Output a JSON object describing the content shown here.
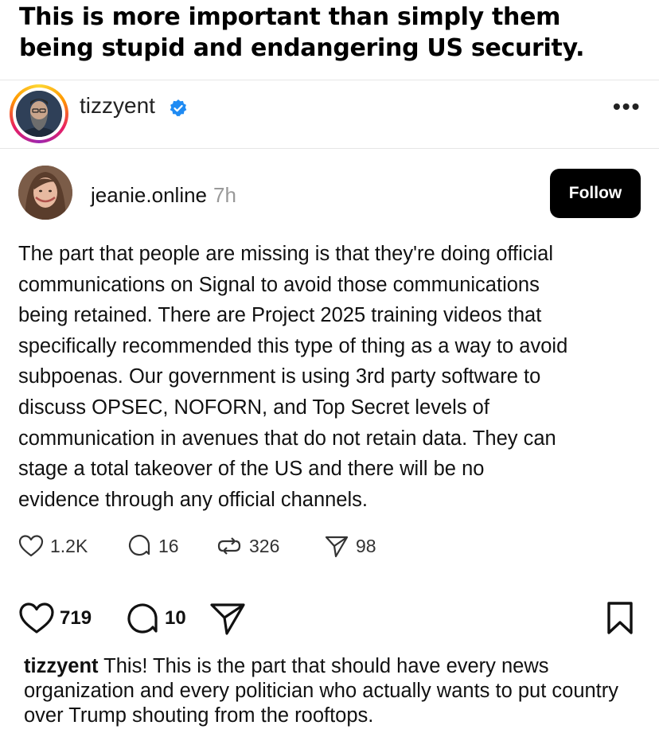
{
  "caption": {
    "line1": "This is more important than simply them",
    "line2": "being stupid and endangering US security."
  },
  "header": {
    "username": "tizzyent",
    "verified_icon": "verified-badge-icon",
    "more_label": "•••"
  },
  "post": {
    "username": "jeanie.online",
    "time": "7h",
    "follow_label": "Follow",
    "lines": [
      "The part that people are missing is that they're doing official",
      "communications on Signal to avoid those communications",
      "being retained. There are Project 2025 training videos that",
      "specifically recommended this type of thing as a way to avoid",
      "subpoenas. Our government is using 3rd party software to",
      "discuss OPSEC, NOFORN, and Top Secret levels of",
      "communication in avenues that do not retain data. They can",
      "stage a total takeover of the US and there will be no",
      "evidence through any official channels."
    ],
    "stats": {
      "likes": "1.2K",
      "replies": "16",
      "reposts": "326",
      "shares": "98"
    }
  },
  "actions": {
    "likes": "719",
    "comments": "10"
  },
  "comment": {
    "username": "tizzyent",
    "text": "This! This is the part that should have every news organization and every politician who actually wants to put country over Trump shouting from the rooftops."
  },
  "colors": {
    "verified": "#1f8bf3",
    "follow_bg": "#000000",
    "muted": "#999999"
  }
}
